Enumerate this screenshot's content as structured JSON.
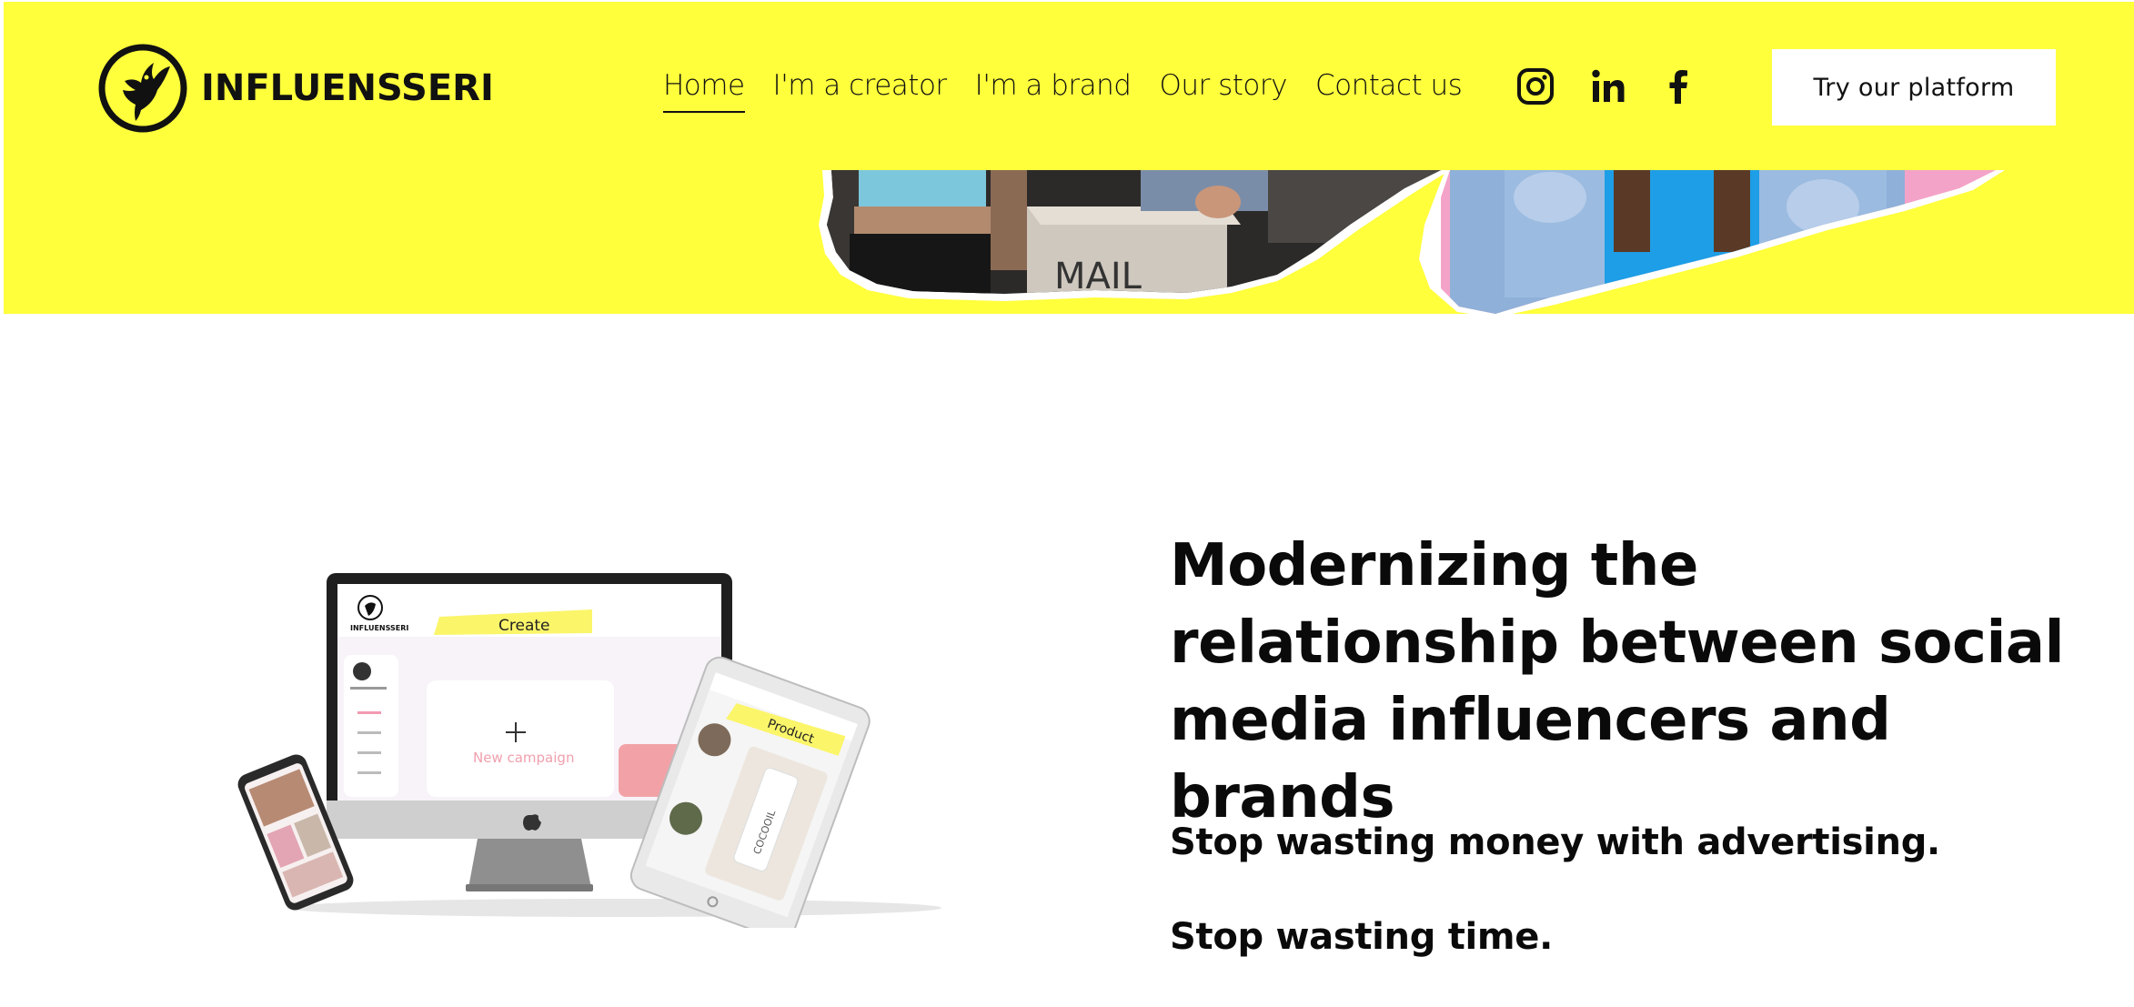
{
  "brand": {
    "name": "INFLUENSSERI"
  },
  "nav": {
    "items": [
      {
        "label": "Home",
        "active": true
      },
      {
        "label": "I'm a creator",
        "active": false
      },
      {
        "label": "I'm a brand",
        "active": false
      },
      {
        "label": "Our story",
        "active": false
      },
      {
        "label": "Contact us",
        "active": false
      }
    ]
  },
  "social": [
    {
      "icon": "instagram-icon"
    },
    {
      "icon": "linkedin-icon"
    },
    {
      "icon": "facebook-icon"
    }
  ],
  "cta": {
    "label": "Try our platform"
  },
  "hero": {
    "mailbox_text": "MAIL"
  },
  "mockup": {
    "create_label": "Create",
    "new_campaign_label": "New campaign",
    "product_label": "Product",
    "bottle_label": "COCOOIL"
  },
  "main": {
    "headline": "Modernizing the relationship between social media influencers and brands",
    "sub1": "Stop wasting money with advertising.",
    "sub2": "Stop wasting time."
  },
  "colors": {
    "accent": "#ffff3c",
    "text": "#111111",
    "white": "#ffffff"
  }
}
